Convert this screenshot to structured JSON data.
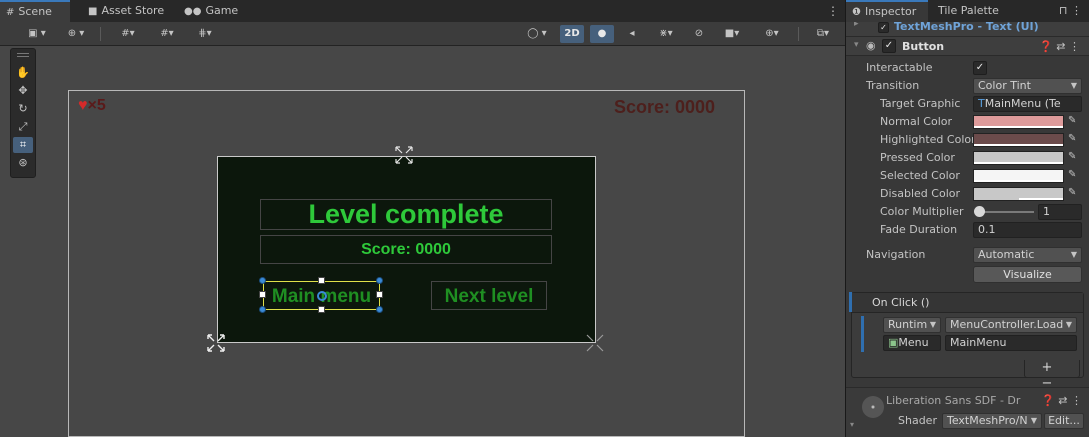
{
  "scene_tabs": [
    {
      "label": "Scene",
      "icon": "grid-icon"
    },
    {
      "label": "Asset Store",
      "icon": "bag-icon"
    },
    {
      "label": "Game",
      "icon": "gamepad-icon"
    }
  ],
  "scene_toolbar": {
    "mode_2d_label": "2D"
  },
  "game_view": {
    "lives": "×5",
    "hud_score": "Score: 0000",
    "level_title": "Level complete",
    "level_score": "Score: 0000",
    "main_menu_label": "Main menu",
    "next_level_label": "Next level"
  },
  "inspector": {
    "tabs": [
      "Inspector",
      "Tile Palette"
    ],
    "parent_component": "TextMeshPro - Text (UI)",
    "component_title": "Button",
    "interactable_label": "Interactable",
    "interactable_checked": "✓",
    "transition_label": "Transition",
    "transition_value": "Color Tint",
    "target_graphic_label": "Target Graphic",
    "target_graphic_value": "MainMenu (Te",
    "colors": [
      {
        "label": "Normal Color",
        "hex": "#de9b9b"
      },
      {
        "label": "Highlighted Color",
        "hex": "#6b4b4b"
      },
      {
        "label": "Pressed Color",
        "hex": "#c8c8c8"
      },
      {
        "label": "Selected Color",
        "hex": "#f5f5f5"
      },
      {
        "label": "Disabled Color",
        "hex": "#c8c8c8"
      }
    ],
    "color_multiplier_label": "Color Multiplier",
    "color_multiplier_value": "1",
    "fade_duration_label": "Fade Duration",
    "fade_duration_value": "0.1",
    "navigation_label": "Navigation",
    "navigation_value": "Automatic",
    "visualize_label": "Visualize",
    "onclick_title": "On Click ()",
    "event": {
      "runtime": "Runtim",
      "function": "MenuController.Load",
      "object": "Menu",
      "argument": "MainMenu"
    },
    "plus_minus": "+ −",
    "font_asset": "Liberation Sans SDF - Dr",
    "shader_label": "Shader",
    "shader_value": "TextMeshPro/N",
    "edit_label": "Edit..."
  }
}
